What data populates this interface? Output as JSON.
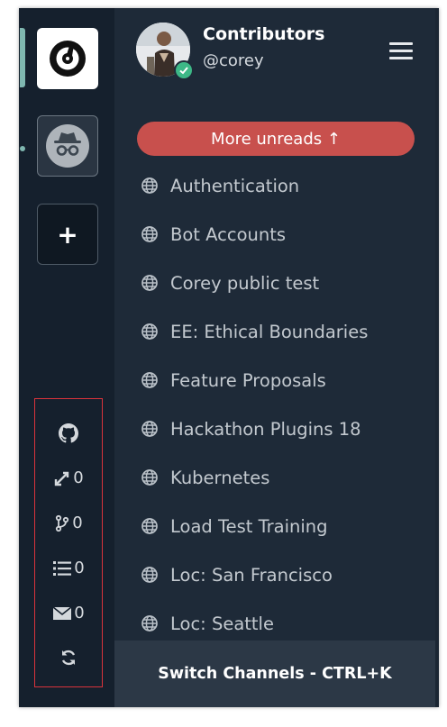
{
  "team": {
    "name": "Contributors",
    "username": "@corey"
  },
  "teams_rail": {
    "items": [
      {
        "name": "mattermost-logo",
        "active": true
      },
      {
        "name": "incognito-icon",
        "unread": true
      },
      {
        "name": "add-team",
        "label": "+"
      }
    ]
  },
  "github": {
    "icons": [
      "github-icon",
      "review-icon",
      "merge-icon",
      "list-icon",
      "mail-icon",
      "refresh-icon"
    ],
    "reviews": "0",
    "prs": "0",
    "assignments": "0",
    "unread_messages": "0"
  },
  "sidebar": {
    "more_unreads": "More unreads ↑",
    "channels": [
      "Authentication",
      "Bot Accounts",
      "Corey public test",
      "EE: Ethical Boundaries",
      "Feature Proposals",
      "Hackathon Plugins 18",
      "Kubernetes",
      "Load Test Training",
      "Loc: San Francisco",
      "Loc: Seattle"
    ],
    "switch_channels": "Switch Channels - CTRL+K"
  },
  "colors": {
    "rail_bg": "#15202d",
    "sidebar_bg": "#1e2a38",
    "accent_teal": "#7fb7b0",
    "unreads_red": "#c8504d",
    "online_green": "#3db887",
    "highlight_box": "#d9333b"
  }
}
